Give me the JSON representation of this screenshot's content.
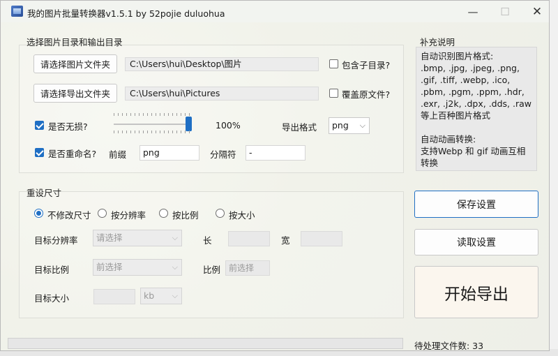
{
  "window": {
    "title": "我的图片批量转换器v1.5.1 by 52pojie duluohua",
    "min_glyph": "—",
    "max_glyph": "☐",
    "close_glyph": "✕"
  },
  "dirs": {
    "group_title": "选择图片目录和输出目录",
    "select_image_folder_label": "请选择图片文件夹",
    "image_folder_path": "C:\\Users\\hui\\Desktop\\图片",
    "include_subdirs_label": "包含子目录?",
    "include_subdirs_checked": false,
    "select_export_folder_label": "请选择导出文件夹",
    "export_folder_path": "C:\\Users\\hui\\Pictures",
    "overwrite_label": "覆盖原文件?",
    "overwrite_checked": false,
    "lossless_label": "是否无损?",
    "lossless_checked": true,
    "quality_value": 1.0,
    "quality_text": "100%",
    "export_format_label": "导出格式",
    "export_format_value": "png",
    "rename_label": "是否重命名?",
    "rename_checked": true,
    "prefix_label": "前缀",
    "prefix_value": "png",
    "separator_label": "分隔符",
    "separator_value": "-"
  },
  "notes": {
    "title": "补充说明",
    "text": "自动识别图片格式:\n.bmp, .jpg, .jpeg, .png, .gif, .tiff, .webp, .ico, .pbm, .pgm, .ppm, .hdr, .exr, .j2k, .dpx, .dds, .raw\n等上百种图片格式\n\n自动动画转换:\n支持Webp 和 gif 动画互相转换"
  },
  "resize": {
    "group_title": "重设尺寸",
    "options": [
      "不修改尺寸",
      "按分辨率",
      "按比例",
      "按大小"
    ],
    "selected_option": "不修改尺寸",
    "target_resolution_label": "目标分辨率",
    "resolution_placeholder": "请选择",
    "length_label": "长",
    "width_label": "宽",
    "target_ratio_label": "目标比例",
    "ratio_placeholder": "前选择",
    "ratio_label": "比例",
    "ratio_field_placeholder": "前选择",
    "target_size_label": "目标大小",
    "size_unit": "kb"
  },
  "actions": {
    "save_label": "保存设置",
    "load_label": "读取设置",
    "export_label": "开始导出"
  },
  "status": {
    "pending_text": "待处理文件数: 33",
    "progress": 0
  },
  "colors": {
    "accent": "#1f6fc4",
    "window_bg": "#f4f4ef"
  }
}
